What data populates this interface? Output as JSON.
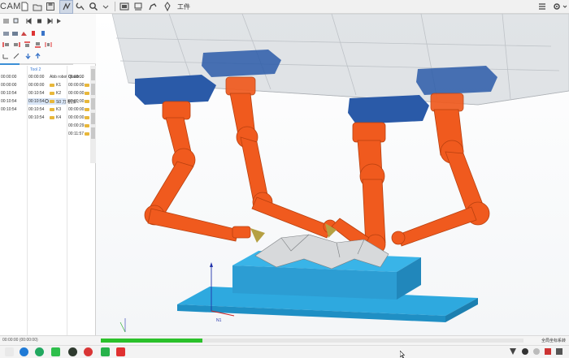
{
  "toolbar": {
    "brand_partial": "CAM",
    "work_label": "工件"
  },
  "left_panel": {
    "col1_title": "",
    "col2_title": "Tool 2",
    "col1_times": [
      "00:00:00",
      "00:00:00",
      "00:10:54",
      "00:10:54",
      "00:10:54"
    ],
    "col2_rows": [
      {
        "time": "00:00:00",
        "label": "Abb robot Quadr..."
      },
      {
        "time": "00:00:00",
        "label": "K1"
      },
      {
        "time": "00:10:54",
        "label": "K2"
      },
      {
        "time": "00:10:54",
        "label": "S0 刀路(加..."
      },
      {
        "time": "00:10:54",
        "label": "K3"
      },
      {
        "time": "00:10:54",
        "label": "K4"
      }
    ],
    "col3_times": [
      "00:00:00",
      "00:00:00",
      "00:00:00",
      "00:00:00",
      "00:00:00",
      "00:00:00",
      "00:00:29",
      "00:11:57"
    ],
    "progress_fraction": 0.27
  },
  "viewport": {
    "axis_label_n1": "N1",
    "colors": {
      "robot": "#f05a1e",
      "base": "#2ea9df",
      "mount": "#2a5aa8",
      "frame": "#c9ced4",
      "workpiece": "#d7d9db"
    }
  },
  "status": {
    "time": "00:00:00 (00:00:00)",
    "progress_fraction": 0.24,
    "right_text": "全局坐标系转"
  },
  "taskbar": {
    "apps": [
      "windows-icon",
      "browser-icon",
      "green-app-icon",
      "chrome-icon",
      "red-app-icon",
      "cam-green-icon",
      "cam-red-icon"
    ]
  }
}
